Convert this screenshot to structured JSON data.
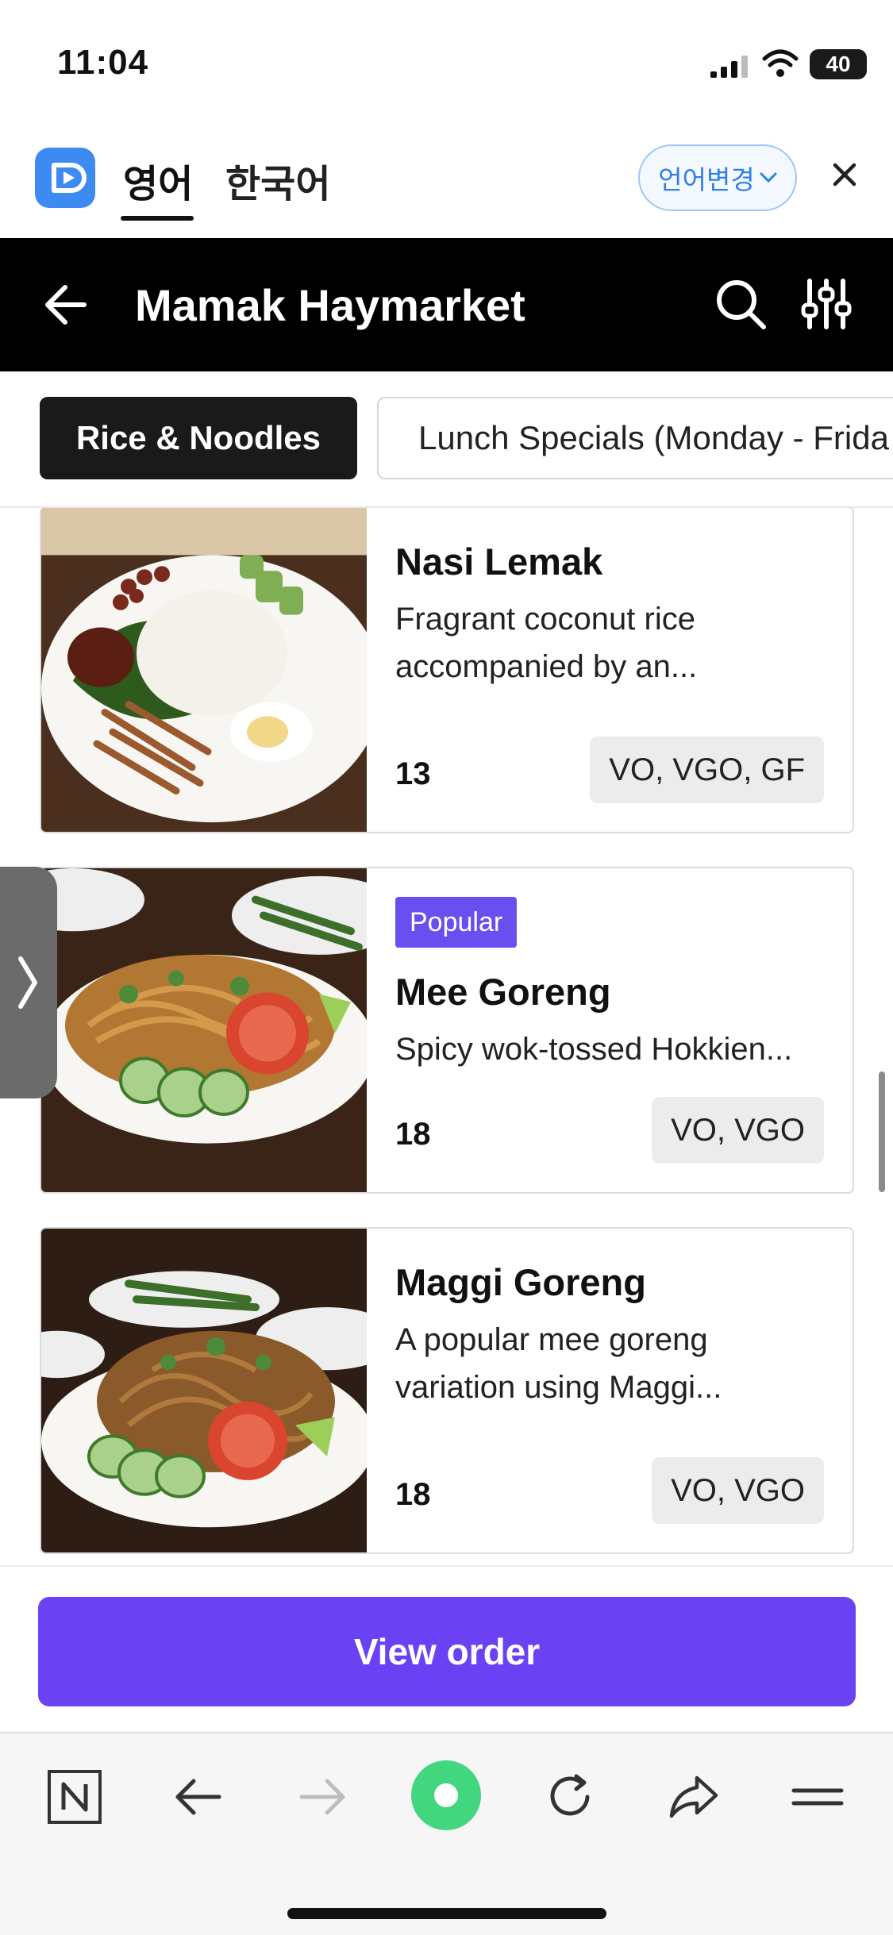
{
  "status_bar": {
    "time": "11:04",
    "battery": "40"
  },
  "language_bar": {
    "tabs": [
      {
        "label": "영어",
        "active": true
      },
      {
        "label": "한국어",
        "active": false
      }
    ],
    "change_button": "언어변경"
  },
  "header": {
    "title": "Mamak Haymarket"
  },
  "categories": [
    {
      "label": "Rice & Noodles",
      "active": true
    },
    {
      "label": "Lunch Specials (Monday - Frida",
      "active": false
    }
  ],
  "menu_items": [
    {
      "name": "Nasi Lemak",
      "description_line1": "Fragrant coconut rice",
      "description_line2": "accompanied by an...",
      "price": "13",
      "tags": "VO, VGO, GF",
      "badge": ""
    },
    {
      "name": "Mee Goreng",
      "description_line1": "Spicy wok-tossed Hokkien...",
      "description_line2": "",
      "price": "18",
      "tags": "VO, VGO",
      "badge": "Popular"
    },
    {
      "name": "Maggi Goreng",
      "description_line1": "A popular mee goreng",
      "description_line2": "variation using Maggi...",
      "price": "18",
      "tags": "VO, VGO",
      "badge": ""
    }
  ],
  "view_order_label": "View order",
  "colors": {
    "accent": "#6a42f3",
    "header_bg": "#000000",
    "lang_accent": "#2f7fe6",
    "logo": "#3d8bf2"
  }
}
